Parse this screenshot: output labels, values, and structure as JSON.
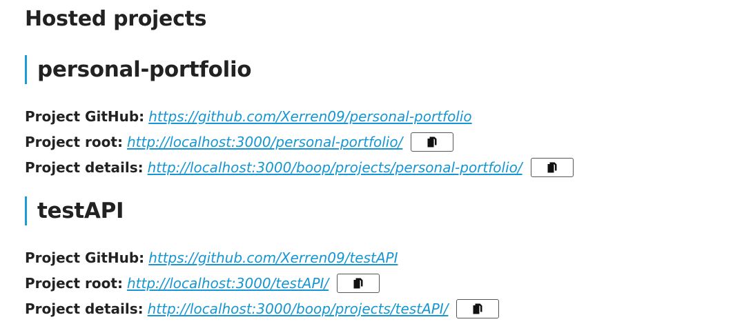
{
  "page": {
    "title": "Hosted projects"
  },
  "projects": [
    {
      "name": "personal-portfolio",
      "rows": [
        {
          "label": "Project GitHub:",
          "link": "https://github.com/Xerren09/personal-portfolio",
          "copy": false
        },
        {
          "label": "Project root:",
          "link": "http://localhost:3000/personal-portfolio/",
          "copy": true
        },
        {
          "label": "Project details:",
          "link": "http://localhost:3000/boop/projects/personal-portfolio/",
          "copy": true
        }
      ]
    },
    {
      "name": "testAPI",
      "rows": [
        {
          "label": "Project GitHub:",
          "link": "https://github.com/Xerren09/testAPI",
          "copy": false
        },
        {
          "label": "Project root:",
          "link": "http://localhost:3000/testAPI/",
          "copy": true
        },
        {
          "label": "Project details:",
          "link": "http://localhost:3000/boop/projects/testAPI/",
          "copy": true
        }
      ]
    }
  ],
  "icons": {
    "copy": "copy-icon"
  },
  "colors": {
    "link": "#1596d2",
    "accent_border": "#1a9ad6",
    "text": "#222222"
  }
}
